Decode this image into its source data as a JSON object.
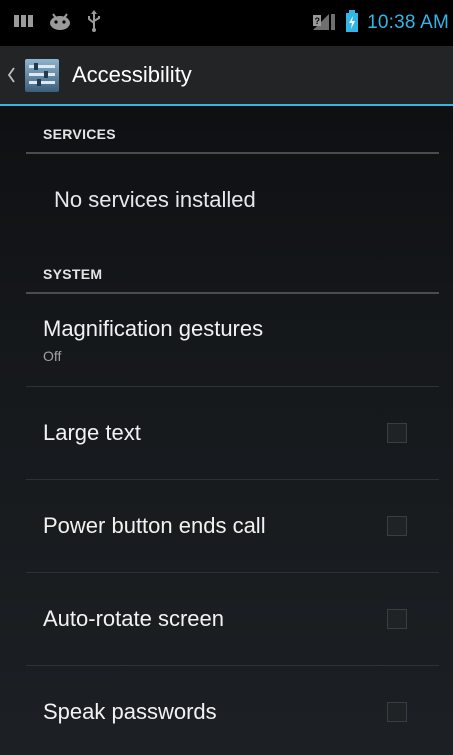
{
  "status_bar": {
    "icons_left": [
      "bars-icon",
      "android-icon",
      "usb-icon"
    ],
    "icons_right": [
      "no-sim-icon",
      "battery-icon"
    ],
    "time": "10:38 AM",
    "accent": "#33b5e5"
  },
  "action_bar": {
    "title": "Accessibility",
    "up_icon": "chevron-left-icon",
    "app_icon": "settings-app-icon"
  },
  "services": {
    "header": "SERVICES",
    "empty_text": "No services installed"
  },
  "system": {
    "header": "SYSTEM",
    "items": [
      {
        "title": "Magnification gestures",
        "summary": "Off",
        "checkbox": false
      },
      {
        "title": "Large text",
        "checked": false
      },
      {
        "title": "Power button ends call",
        "checked": false
      },
      {
        "title": "Auto-rotate screen",
        "checked": false
      },
      {
        "title": "Speak passwords",
        "checked": false
      }
    ]
  }
}
